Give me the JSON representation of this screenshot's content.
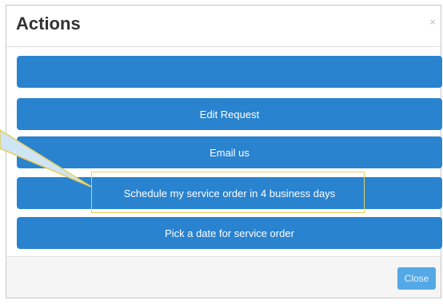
{
  "modal": {
    "title": "Actions",
    "close_glyph": "×"
  },
  "actions": [
    {
      "label": ""
    },
    {
      "label": "Edit Request"
    },
    {
      "label": "Email us"
    },
    {
      "label": "Schedule my service order in 4 business days"
    },
    {
      "label": "Pick a date for service order"
    }
  ],
  "footer": {
    "close_label": "Close"
  },
  "colors": {
    "button_blue": "#2a83cf",
    "highlight_border": "#e6cf5a",
    "callout_fill": "#cfe4f4",
    "callout_stroke": "#e6cf5a"
  },
  "icons": {
    "close": "close-icon"
  }
}
